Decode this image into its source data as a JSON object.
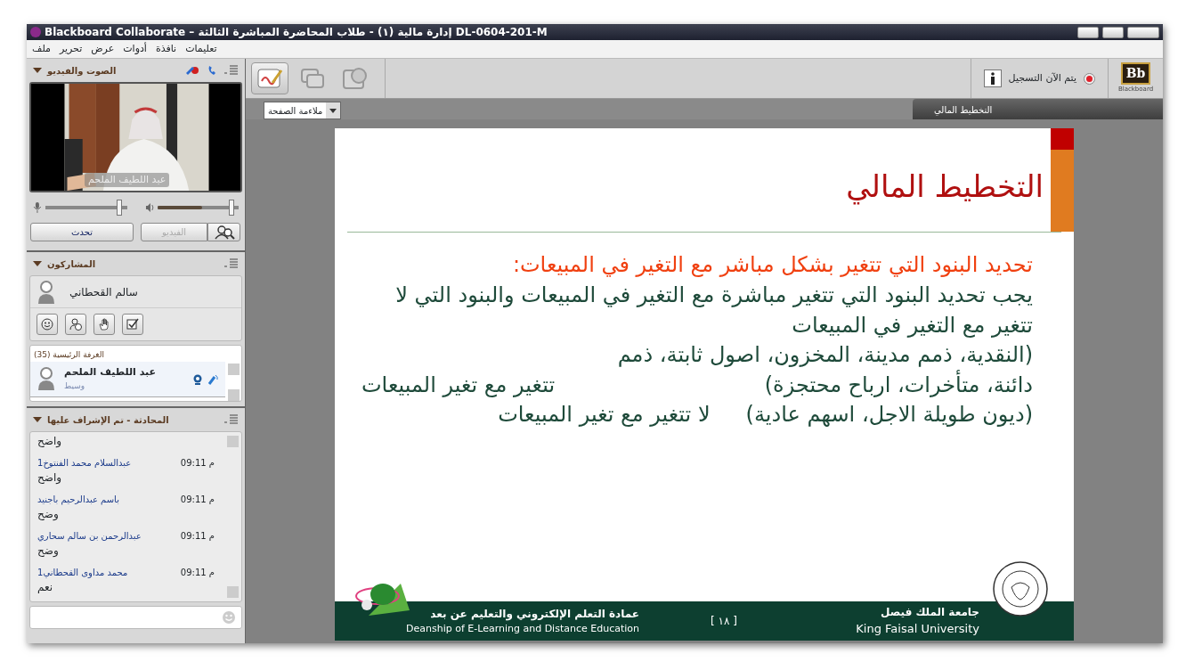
{
  "window": {
    "title": "Blackboard Collaborate – إدارة مالية (١) - طلاب المحاضرة المباشرة الثالثة DL-0604-201-M"
  },
  "menu": [
    "تعليمات",
    "نافذة",
    "أدوات",
    "عرض",
    "تحرير",
    "ملف"
  ],
  "audio_video": {
    "title": "الصوت والفيديو",
    "video_caption": "عبد اللطيف الملحم",
    "mic": {
      "level": 0.92
    },
    "speaker": {
      "level": 0.94
    },
    "speaker_meter": {
      "level": 0.55
    },
    "video_button": {
      "label": "الفيديو",
      "disabled": true
    },
    "talk_button": {
      "label": "تحدث",
      "disabled": false
    }
  },
  "participants": {
    "title": "المشاركون",
    "me": "سالم القحطاني",
    "room": "الغرفة الرئيسية (35)",
    "list": [
      {
        "name": "عبد اللطيف الملحم",
        "role": "وسيط"
      }
    ]
  },
  "chat": {
    "title": "المحادثة - تم الإشراف عليها",
    "messages": [
      {
        "text": "واضح"
      },
      {
        "name": "عبدالسلام محمد الفنتوخ1",
        "time": "م 09:11",
        "text": "واضح"
      },
      {
        "name": "باسم عبدالرحيم باجنيد",
        "time": "م 09:11",
        "text": "وضح"
      },
      {
        "name": "عبدالرحمن بن سالم سحاري",
        "time": "م 09:11",
        "text": "وضح"
      },
      {
        "name": "محمد مداوى القحطاني1",
        "time": "م 09:11",
        "text": "نعم"
      }
    ]
  },
  "toolbar": {
    "tools": [
      {
        "kind": "whiteboard",
        "selected": true
      },
      {
        "kind": "app-share",
        "selected": false
      },
      {
        "kind": "web-tour",
        "selected": false
      }
    ],
    "recording": "يتم الآن التسجيل",
    "logo": "Bb",
    "logo_caption": "Blackboard"
  },
  "view": {
    "zoom": "ملاءمة الصفحة",
    "tab": "التخطيط المالي"
  },
  "slide": {
    "title": "التخطيط المالي",
    "heading": "تحديد البنود التي تتغير بشكل مباشر مع التغير في المبيعات:",
    "paragraph": "يجب تحديد البنود التي تتغير مباشرة مع التغير في المبيعات والبنود التي لا تتغير مع التغير في المبيعات",
    "items": [
      {
        "text": "(النقدية، ذمم مدينة، المخزون، اصول ثابتة، ذمم دائنة، متأخرات، ارباح محتجزة)",
        "effect": "تتغير مع تغير المبيعات"
      },
      {
        "text": "(ديون طويلة الاجل، اسهم عادية)",
        "effect": "لا تتغير مع تغير المبيعات"
      }
    ],
    "footer": {
      "deanship_ar": "عمادة التعلم الإلكتروني والتعليم عن بعد",
      "deanship_en": "Deanship of E-Learning and Distance Education",
      "page": "[ ١٨ ]",
      "university_ar": "جامعة الملك فيصل",
      "university_en": "King Faisal University"
    }
  }
}
